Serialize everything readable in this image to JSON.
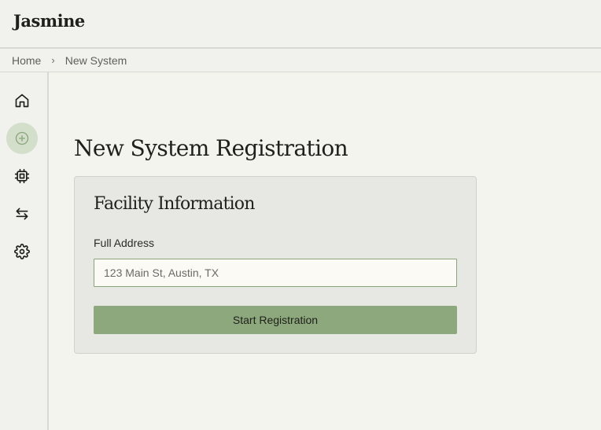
{
  "app": {
    "name": "Jasmine"
  },
  "breadcrumb": {
    "items": [
      "Home",
      "New System"
    ],
    "separator": "›"
  },
  "sidebar": {
    "items": [
      {
        "icon": "home-icon",
        "active": false
      },
      {
        "icon": "plus-circle-icon",
        "active": true
      },
      {
        "icon": "chip-icon",
        "active": false
      },
      {
        "icon": "transfer-arrows-icon",
        "active": false
      },
      {
        "icon": "gear-icon",
        "active": false
      }
    ]
  },
  "page": {
    "title": "New System Registration"
  },
  "form": {
    "section_title": "Facility Information",
    "address_label": "Full Address",
    "address_placeholder": "123 Main St, Austin, TX",
    "address_value": "",
    "submit_label": "Start Registration"
  },
  "colors": {
    "accent": "#8da87c",
    "active_nav_bg": "#d4dfcb",
    "input_border": "#8aa47a"
  }
}
